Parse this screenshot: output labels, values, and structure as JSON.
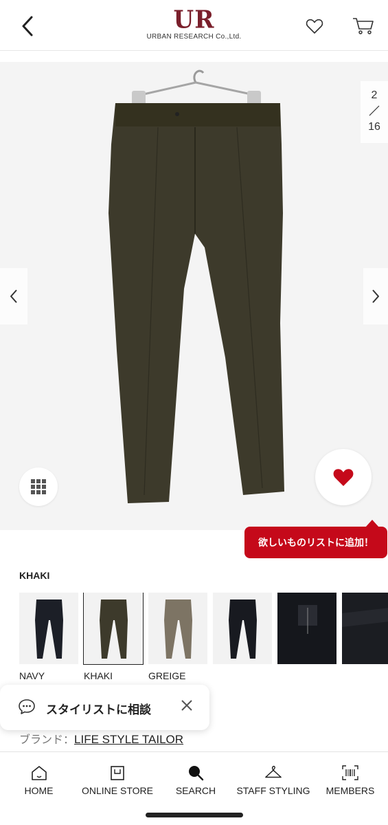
{
  "header": {
    "logo_mark": "UR",
    "logo_sub": "URBAN RESEARCH Co.,Ltd."
  },
  "gallery": {
    "current_page": "2",
    "total_pages": "16"
  },
  "wish_tooltip": "欲しいものリストに追加！",
  "color": {
    "selected_label": "KHAKI",
    "swatches": [
      {
        "name": "NAVY"
      },
      {
        "name": "KHAKI"
      },
      {
        "name": "GREIGE"
      },
      {
        "name": ""
      },
      {
        "name": ""
      },
      {
        "name": ""
      }
    ]
  },
  "stylist": {
    "label": "スタイリストに相談"
  },
  "brand": {
    "prefix": "ブランド：",
    "name": "LIFE STYLE TAILOR"
  },
  "bottom_nav": [
    {
      "label": "HOME",
      "icon": "home-icon"
    },
    {
      "label": "ONLINE STORE",
      "icon": "shopping-bag-icon"
    },
    {
      "label": "SEARCH",
      "icon": "search-icon"
    },
    {
      "label": "STAFF STYLING",
      "icon": "hanger-icon"
    },
    {
      "label": "MEMBERS",
      "icon": "barcode-icon"
    }
  ],
  "colors": {
    "brand": "#7a1f2b",
    "accent_red": "#c5091a",
    "pants_khaki": "#3d3a2b",
    "pants_navy": "#1c1f27",
    "pants_greige": "#7d7464"
  }
}
